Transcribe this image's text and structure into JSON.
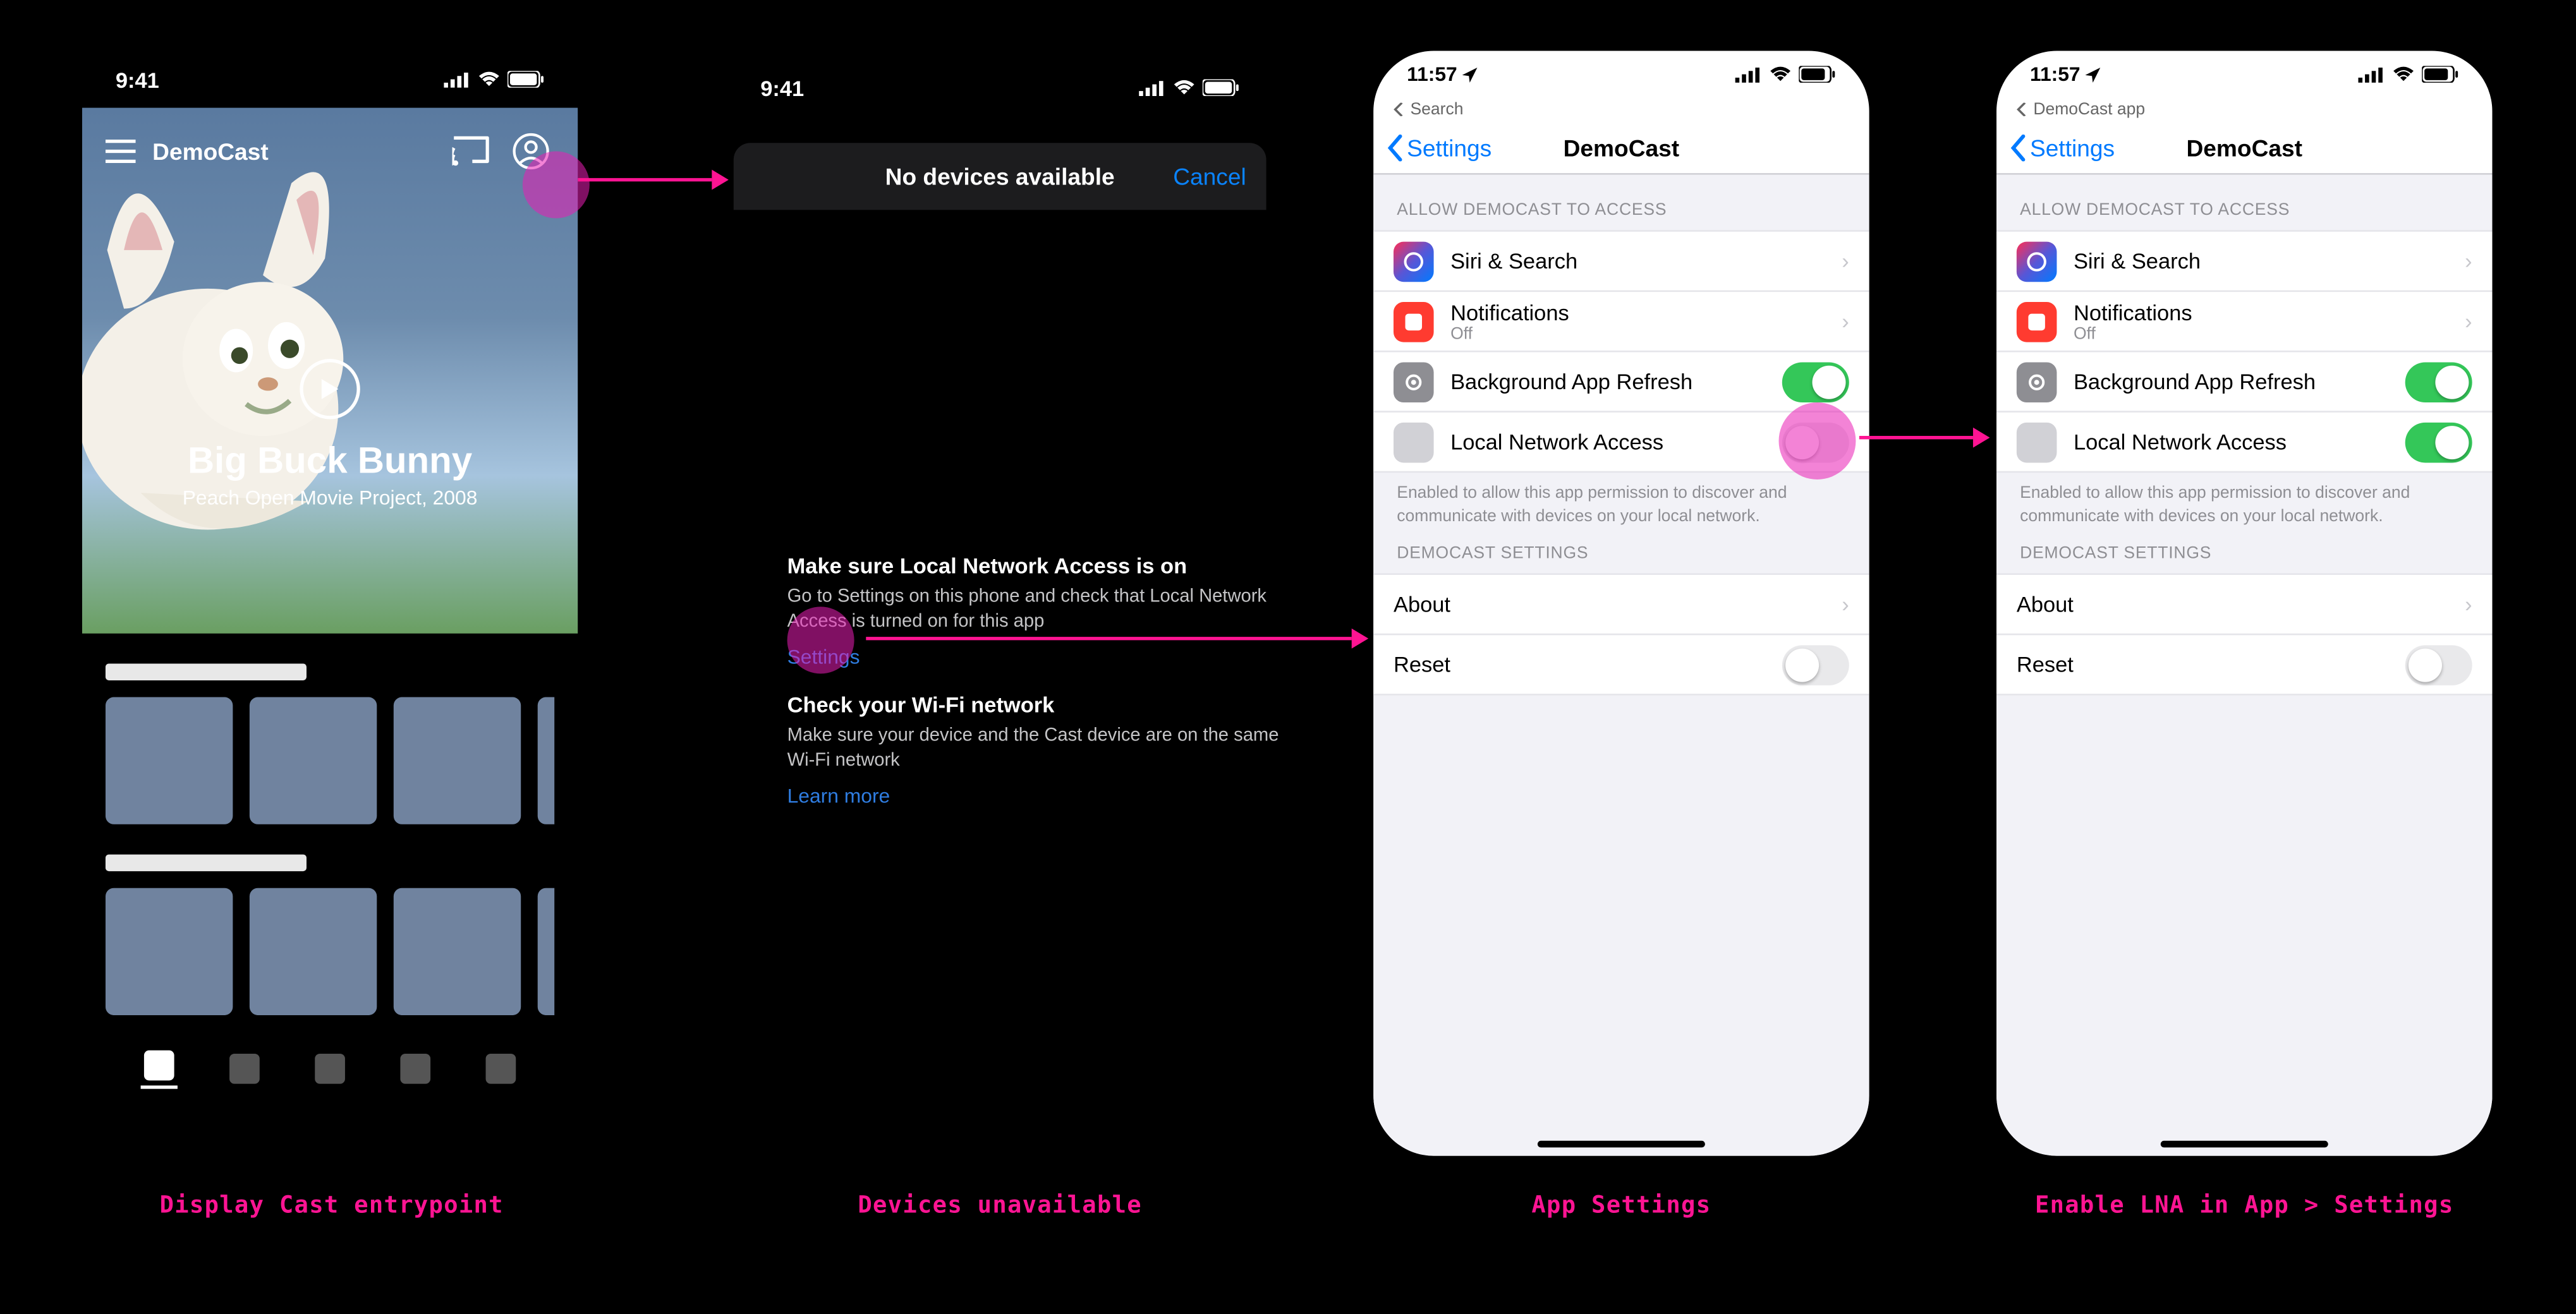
{
  "frames": {
    "f1": {
      "time": "9:41",
      "app": "DemoCast",
      "hero": {
        "title": "Big Buck Bunny",
        "subtitle": "Peach Open Movie Project, 2008"
      },
      "caption": "Display Cast entrypoint"
    },
    "f2": {
      "time": "9:41",
      "modal": {
        "title": "No devices available",
        "cancel": "Cancel"
      },
      "help1": {
        "title": "Make sure Local Network Access is on",
        "body": "Go to Settings on this phone and check that Local Network Access is turned on for this app",
        "link": "Settings"
      },
      "help2": {
        "title": "Check your Wi‑Fi network",
        "body": "Make sure your device and the Cast device are on the same Wi‑Fi network",
        "link": "Learn more"
      },
      "caption": "Devices unavailable"
    },
    "f3": {
      "time": "11:57",
      "crumb": "Search",
      "back": "Settings",
      "title": "DemoCast",
      "access_h": "ALLOW DEMOCAST TO ACCESS",
      "rows": {
        "siri": "Siri & Search",
        "notif": "Notifications",
        "notif_sub": "Off",
        "bg": "Background App Refresh",
        "lna": "Local Network Access"
      },
      "footnote": "Enabled to allow this app permission to discover and communicate with devices on your local network.",
      "settings_h": "DEMOCAST SETTINGS",
      "about": "About",
      "reset": "Reset",
      "caption": "App Settings"
    },
    "f4": {
      "time": "11:57",
      "crumb": "DemoCast app",
      "back": "Settings",
      "title": "DemoCast",
      "caption": "Enable LNA in App > Settings"
    }
  }
}
